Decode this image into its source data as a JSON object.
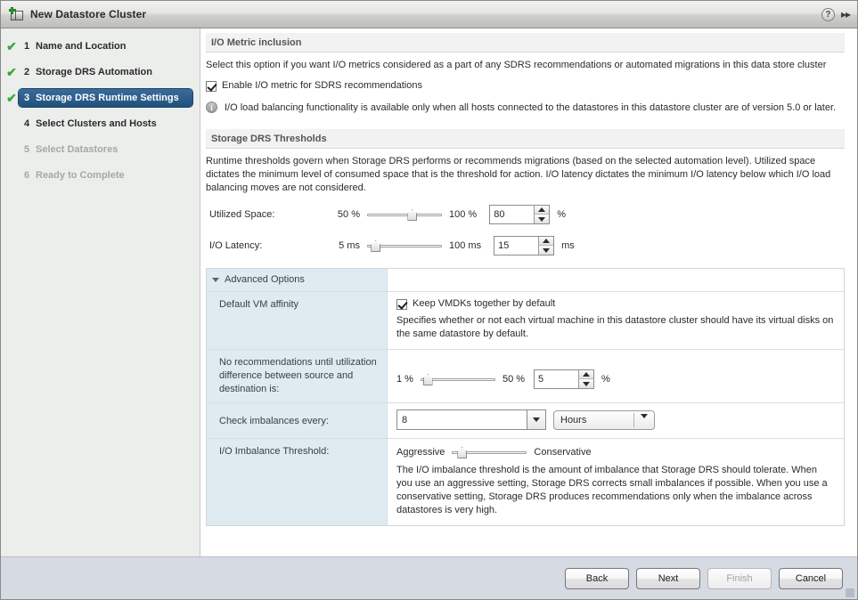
{
  "window": {
    "title": "New Datastore Cluster",
    "icon": "datastore-add-icon",
    "help_icon": "?",
    "expand_icon": "▸▸"
  },
  "sidebar": {
    "steps": [
      {
        "num": "1",
        "label": "Name and Location",
        "state": "done",
        "check": "✔"
      },
      {
        "num": "2",
        "label": "Storage DRS Automation",
        "state": "done",
        "check": "✔"
      },
      {
        "num": "3",
        "label": "Storage DRS Runtime Settings",
        "state": "active",
        "check": "✔"
      },
      {
        "num": "4",
        "label": "Select Clusters and Hosts",
        "state": "pending",
        "check": ""
      },
      {
        "num": "5",
        "label": "Select Datastores",
        "state": "disabled",
        "check": ""
      },
      {
        "num": "6",
        "label": "Ready to Complete",
        "state": "disabled",
        "check": ""
      }
    ]
  },
  "io_metric": {
    "heading": "I/O Metric inclusion",
    "description": "Select this option if you want I/O metrics considered as a part of any SDRS recommendations or automated migrations in this data store cluster",
    "checkbox_label": "Enable I/O metric for SDRS recommendations",
    "checkbox_checked": true,
    "info_icon": "i",
    "info_text": "I/O load balancing functionality is available only when all hosts connected to the datastores in this datastore cluster are of version 5.0 or later."
  },
  "thresholds": {
    "heading": "Storage DRS Thresholds",
    "description": "Runtime thresholds govern when Storage DRS performs or recommends migrations (based on the selected automation level). Utilized space dictates the minimum level of consumed space that is the threshold for action. I/O latency dictates the minimum I/O latency below which I/O load balancing moves are not considered.",
    "rows": [
      {
        "label": "Utilized Space:",
        "min": "50 %",
        "max": "100 %",
        "value": "80",
        "unit": "%",
        "slider_percent": 60
      },
      {
        "label": "I/O Latency:",
        "min": "5 ms",
        "max": "100 ms",
        "value": "15",
        "unit": "ms",
        "slider_percent": 11
      }
    ]
  },
  "advanced": {
    "title": "Advanced Options",
    "expanded": true,
    "vm_affinity": {
      "label": "Default VM affinity",
      "checkbox_label": "Keep VMDKs together by default",
      "checkbox_checked": true,
      "description": "Specifies whether or not each virtual machine in this datastore cluster should have its virtual disks on the same datastore by default."
    },
    "utilization_difference": {
      "label": "No recommendations until utilization difference between source and destination is:",
      "min": "1 %",
      "max": "50 %",
      "value": "5",
      "unit": "%",
      "slider_percent": 9
    },
    "check_imbalances": {
      "label": "Check imbalances every:",
      "value": "8",
      "unit_value": "Hours"
    },
    "io_imbalance": {
      "label": "I/O Imbalance Threshold:",
      "min": "Aggressive",
      "max": "Conservative",
      "slider_percent": 13,
      "description": "The I/O imbalance threshold is the amount of imbalance that Storage DRS should tolerate. When you use an aggressive setting, Storage DRS corrects small imbalances if possible. When you use a conservative setting, Storage DRS produces recommendations only when the imbalance across datastores is very high."
    }
  },
  "footer": {
    "buttons": [
      {
        "label": "Back",
        "disabled": false
      },
      {
        "label": "Next",
        "disabled": false
      },
      {
        "label": "Finish",
        "disabled": true
      },
      {
        "label": "Cancel",
        "disabled": false
      }
    ]
  }
}
